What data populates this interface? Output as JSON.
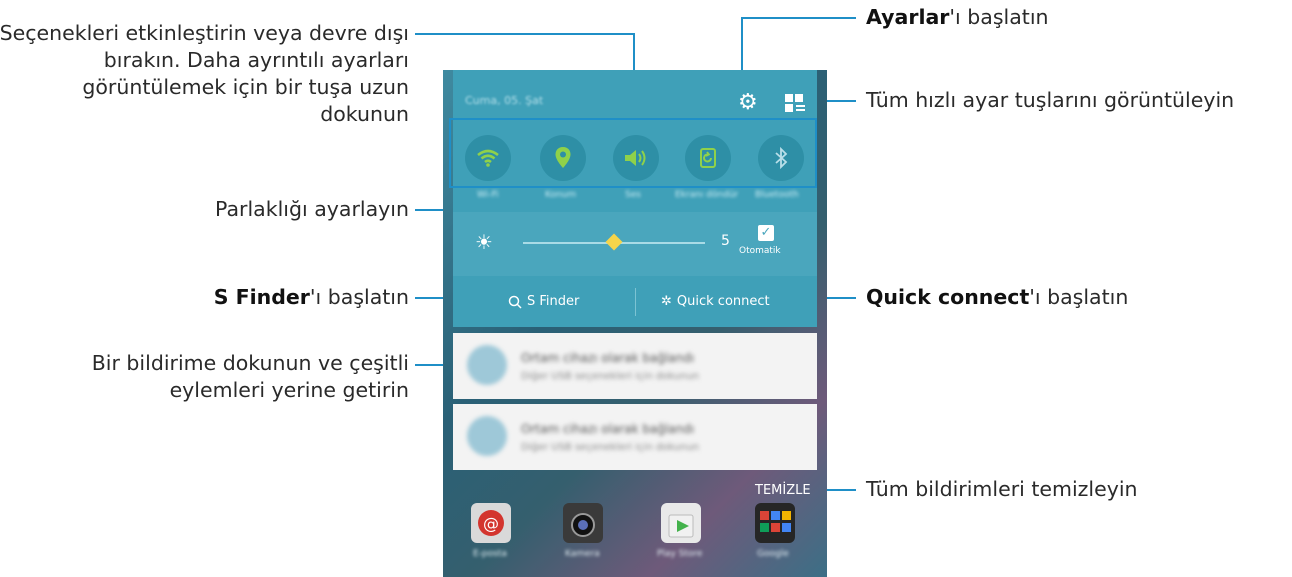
{
  "annotations": {
    "toggle_options": "Seçenekleri etkinleştirin veya devre dışı bırakın. Daha ayrıntılı ayarları görüntülemek için bir tuşa uzun dokunun",
    "brightness": "Parlaklığı ayarlayın",
    "s_finder_bold": "S Finder",
    "s_finder_rest": "'ı başlatın",
    "notification": "Bir bildirime dokunun ve çeşitli eylemleri yerine getirin",
    "settings_bold": "Ayarlar",
    "settings_rest": "'ı başlatın",
    "all_quick": "Tüm hızlı ayar tuşlarını görüntüleyin",
    "quick_connect_bold": "Quick connect",
    "quick_connect_rest": "'ı başlatın",
    "clear_all": "Tüm bildirimleri temizleyin"
  },
  "phone": {
    "status_date": "Cuma, 05. Şat",
    "quick_buttons": [
      {
        "icon": "wifi-icon",
        "label": "Wi-Fi"
      },
      {
        "icon": "location-icon",
        "label": "Konum"
      },
      {
        "icon": "sound-icon",
        "label": "Ses"
      },
      {
        "icon": "rotate-icon",
        "label": "Ekranı döndür"
      },
      {
        "icon": "bluetooth-icon",
        "label": "Bluetooth"
      }
    ],
    "brightness_value": "5",
    "brightness_level": 0.5,
    "auto_label": "Otomatik",
    "s_finder_label": "S Finder",
    "quick_connect_label": "Quick connect",
    "notifications": [
      {
        "title": "Ortam cihazı olarak bağlandı",
        "subtitle": "Diğer USB seçenekleri için dokunun"
      },
      {
        "title": "Ortam cihazı olarak bağlandı",
        "subtitle": "Diğer USB seçenekleri için dokunun"
      }
    ],
    "clear_label": "TEMİZLE",
    "apps": [
      "E-posta",
      "Kamera",
      "Play Store",
      "Google"
    ]
  },
  "colors": {
    "accent": "#1f8fc7",
    "panel": "#4aa6bd",
    "icon_green": "#8fd14a"
  }
}
